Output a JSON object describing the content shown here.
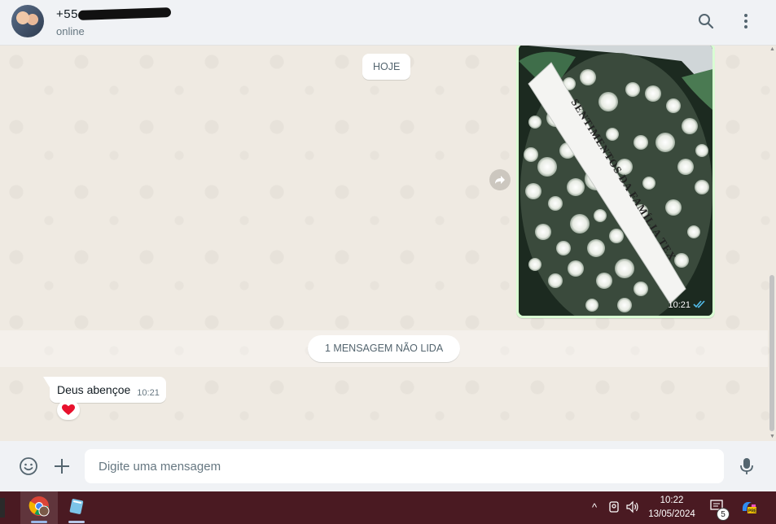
{
  "header": {
    "contact_name": "+55 ",
    "status": "online"
  },
  "chat": {
    "date_label": "HOJE",
    "image_message": {
      "ribbon_text": "SENTIMENTOS DA FAMÍLIA TEX",
      "time": "10:21",
      "read_receipt": "double-check-icon"
    },
    "unread_label": "1 MENSAGEM NÃO LIDA",
    "incoming_message": {
      "text": "Deus abençoe",
      "time": "10:21",
      "reaction": "❤"
    }
  },
  "composer": {
    "placeholder": "Digite uma mensagem"
  },
  "taskbar": {
    "time": "10:22",
    "date": "13/05/2024",
    "notification_count": "5"
  },
  "colors": {
    "chat_bg": "#efeae2",
    "outgoing_bubble": "#d9fdd3",
    "read_tick": "#53bdeb",
    "taskbar_bg": "#4a1a22"
  }
}
